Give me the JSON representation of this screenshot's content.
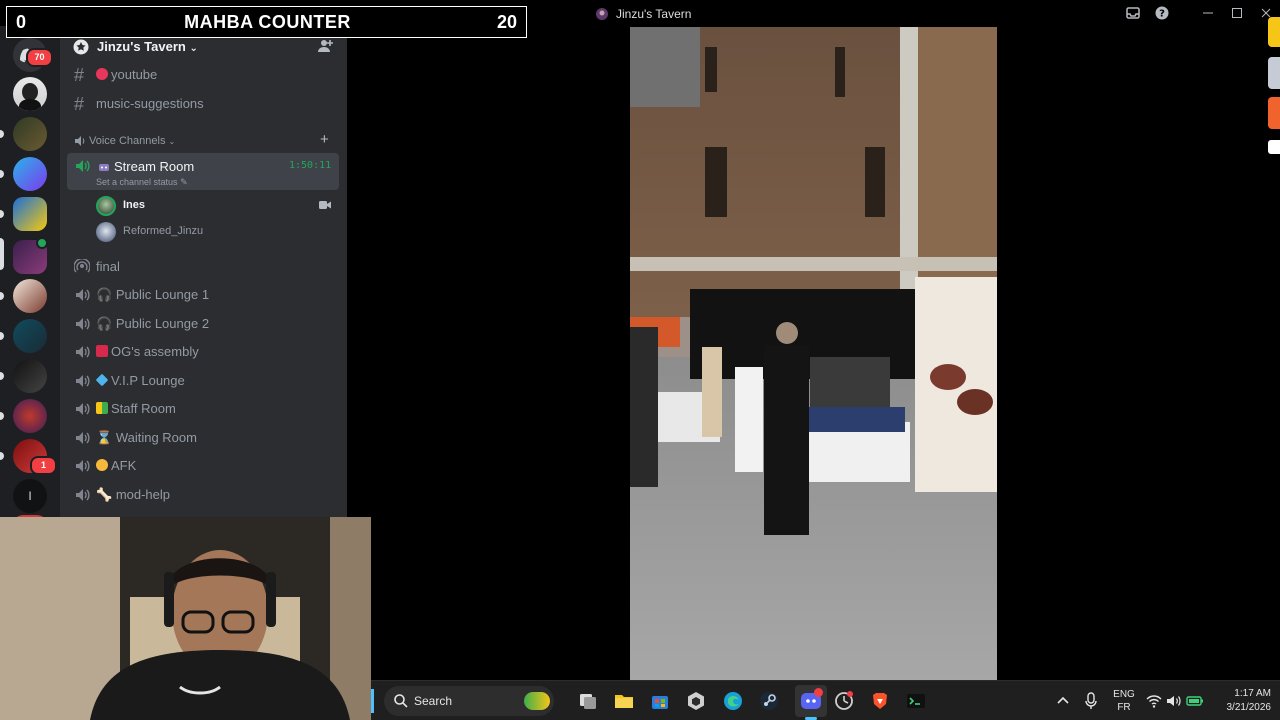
{
  "counter": {
    "left_value": "0",
    "title": "MAHBA COUNTER",
    "right_value": "20"
  },
  "window": {
    "title": "Jinzu's Tavern"
  },
  "rail": {
    "badges": {
      "top": "70",
      "bottom": "1"
    },
    "last_label": "I"
  },
  "server": {
    "name": "Jinzu's Tavern"
  },
  "text_channels": [
    {
      "name": "youtube"
    },
    {
      "name": "music-suggestions"
    }
  ],
  "voice_category": {
    "label": "Voice Channels"
  },
  "stream_room": {
    "name": "Stream Room",
    "status": "Set a channel status",
    "timer": "1:50:11",
    "members": [
      {
        "name": "Ines"
      },
      {
        "name": "Reformed_Jinzu"
      }
    ]
  },
  "voice_channels": [
    {
      "name": "final"
    },
    {
      "name": "Public Lounge 1"
    },
    {
      "name": "Public Lounge 2"
    },
    {
      "name": "OG's assembly"
    },
    {
      "name": "V.I.P Lounge"
    },
    {
      "name": "Staff Room"
    },
    {
      "name": "Waiting Room"
    },
    {
      "name": "AFK"
    },
    {
      "name": "mod-help"
    }
  ],
  "taskbar": {
    "search_label": "Search",
    "lang_top": "ENG",
    "lang_bottom": "FR",
    "time": "1:17 AM",
    "date": "3/21/2026"
  },
  "colors": {
    "accent_green": "#23a55a",
    "badge_red": "#f23f43",
    "panel_bg": "#2b2d31",
    "rail_bg": "#1e1f22"
  }
}
